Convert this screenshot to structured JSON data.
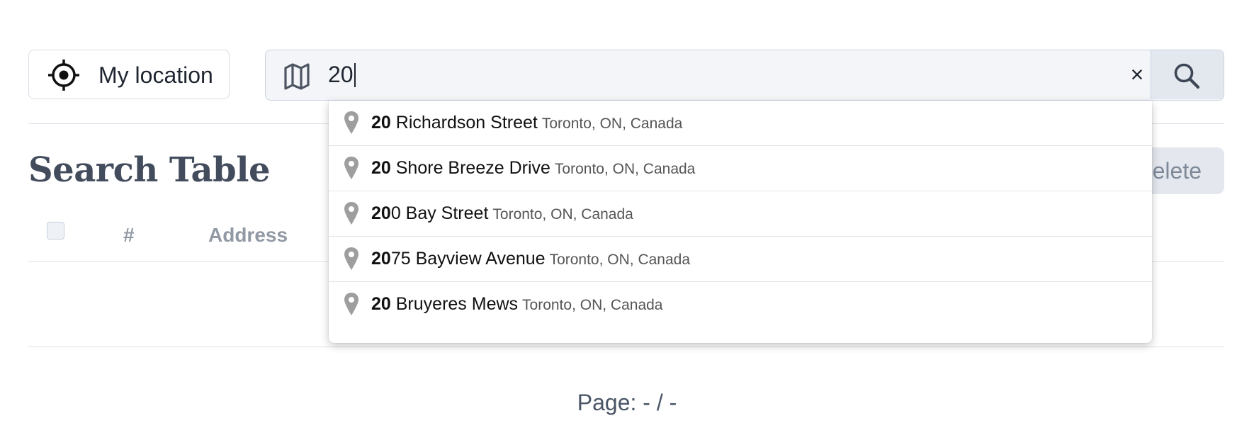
{
  "location_button": {
    "label": "My location",
    "icon": "crosshair-icon"
  },
  "search": {
    "value": "20",
    "map_icon": "map-icon",
    "clear_symbol": "×",
    "submit_icon": "search-icon"
  },
  "page": {
    "title": "Search Table",
    "delete_label": "elete"
  },
  "table": {
    "columns": [
      "#",
      "Address"
    ]
  },
  "pager": {
    "text": "Page: - / -"
  },
  "suggestions": [
    {
      "match": "20",
      "rest": " Richardson Street",
      "secondary": "Toronto, ON, Canada"
    },
    {
      "match": "20",
      "rest": " Shore Breeze Drive",
      "secondary": "Toronto, ON, Canada"
    },
    {
      "match": "20",
      "rest": "0 Bay Street",
      "secondary": "Toronto, ON, Canada"
    },
    {
      "match": "20",
      "rest": "75 Bayview Avenue",
      "secondary": "Toronto, ON, Canada"
    },
    {
      "match": "20",
      "rest": " Bruyeres Mews",
      "secondary": "Toronto, ON, Canada"
    }
  ],
  "colors": {
    "search_background": "#f3f5f8",
    "button_border": "#d8dde5",
    "title": "#424c5c",
    "header_text": "#9199a4",
    "pin": "#9e9e9e"
  }
}
